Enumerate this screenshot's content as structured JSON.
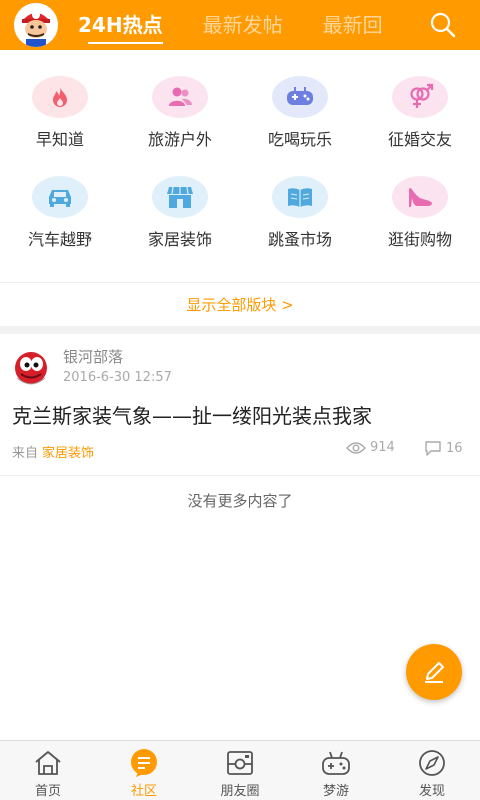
{
  "header": {
    "tabs": [
      {
        "label": "24H热点",
        "active": true
      },
      {
        "label": "最新发帖",
        "active": false
      },
      {
        "label": "最新回",
        "active": false
      }
    ],
    "search_icon": "search-icon",
    "accent": "#ff9a00"
  },
  "categories": [
    {
      "label": "早知道",
      "icon": "flame-icon",
      "bg": "#fde4e6",
      "fg": "#f2606e"
    },
    {
      "label": "旅游户外",
      "icon": "people-icon",
      "bg": "#fbe3f0",
      "fg": "#e66bb0"
    },
    {
      "label": "吃喝玩乐",
      "icon": "gamepad-icon",
      "bg": "#e3e8fb",
      "fg": "#6d7fe0"
    },
    {
      "label": "征婚交友",
      "icon": "gender-icon",
      "bg": "#fbe3f0",
      "fg": "#e66bb0"
    },
    {
      "label": "汽车越野",
      "icon": "car-icon",
      "bg": "#dff0fa",
      "fg": "#4fa9df"
    },
    {
      "label": "家居装饰",
      "icon": "store-icon",
      "bg": "#dff0fa",
      "fg": "#4fa9df"
    },
    {
      "label": "跳蚤市场",
      "icon": "book-icon",
      "bg": "#dff0fa",
      "fg": "#4fa9df"
    },
    {
      "label": "逛街购物",
      "icon": "high-heel-icon",
      "bg": "#fbe3f0",
      "fg": "#e66bb0"
    }
  ],
  "show_all": "显示全部版块 >",
  "post": {
    "user": "银河部落",
    "time": "2016-6-30 12:57",
    "title": "克兰斯家装气象——扯一缕阳光装点我家",
    "from_label": "来自",
    "board": "家居装饰",
    "views": "914",
    "comments": "16"
  },
  "no_more": "没有更多内容了",
  "bottom_nav": [
    {
      "label": "首页",
      "icon": "home-icon",
      "active": false
    },
    {
      "label": "社区",
      "icon": "community-icon",
      "active": true
    },
    {
      "label": "朋友圈",
      "icon": "camera-icon",
      "active": false
    },
    {
      "label": "梦游",
      "icon": "game-controller-icon",
      "active": false
    },
    {
      "label": "发现",
      "icon": "compass-icon",
      "active": false
    }
  ]
}
